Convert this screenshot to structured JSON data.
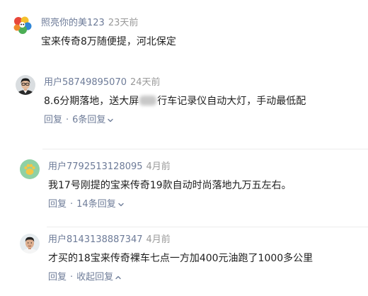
{
  "colors": {
    "background": "#ffffff",
    "username": "#6d7b98",
    "time": "#9a9a9a",
    "text": "#1e1e1e",
    "action": "#6f7d99",
    "divider": "#ececec"
  },
  "comments": [
    {
      "avatar_icon": "colorful-cartoon-avatar",
      "username": "照亮你的美123",
      "time": "23天前",
      "text": "宝来传奇8万随便提，河北保定"
    },
    {
      "avatar_icon": "man-with-glasses-avatar",
      "username": "用户58749895070",
      "time": "24天前",
      "text_before": "8.6分期落地，送大屏",
      "text_after": "行车记录仪自动大灯，手动最低配",
      "reply_label": "回复",
      "separator": "·",
      "replies_label": "6条回复",
      "toggle_icon": "chevron-down-icon"
    },
    {
      "avatar_icon": "green-paw-avatar",
      "username": "用户7792513128095",
      "time": "4月前",
      "text": "我17号刚提的宝来传奇19款自动时尚落地九万五左右。",
      "reply_label": "回复",
      "separator": "·",
      "replies_label": "14条回复",
      "toggle_icon": "chevron-down-icon"
    },
    {
      "avatar_icon": "man-portrait-avatar",
      "username": "用户8143138887347",
      "time": "4月前",
      "text": "才买的18宝来传奇裸车七点一方加400元油跑了1000多公里",
      "reply_label": "回复",
      "separator": "·",
      "replies_label": "收起回复",
      "toggle_icon": "chevron-up-icon"
    }
  ]
}
